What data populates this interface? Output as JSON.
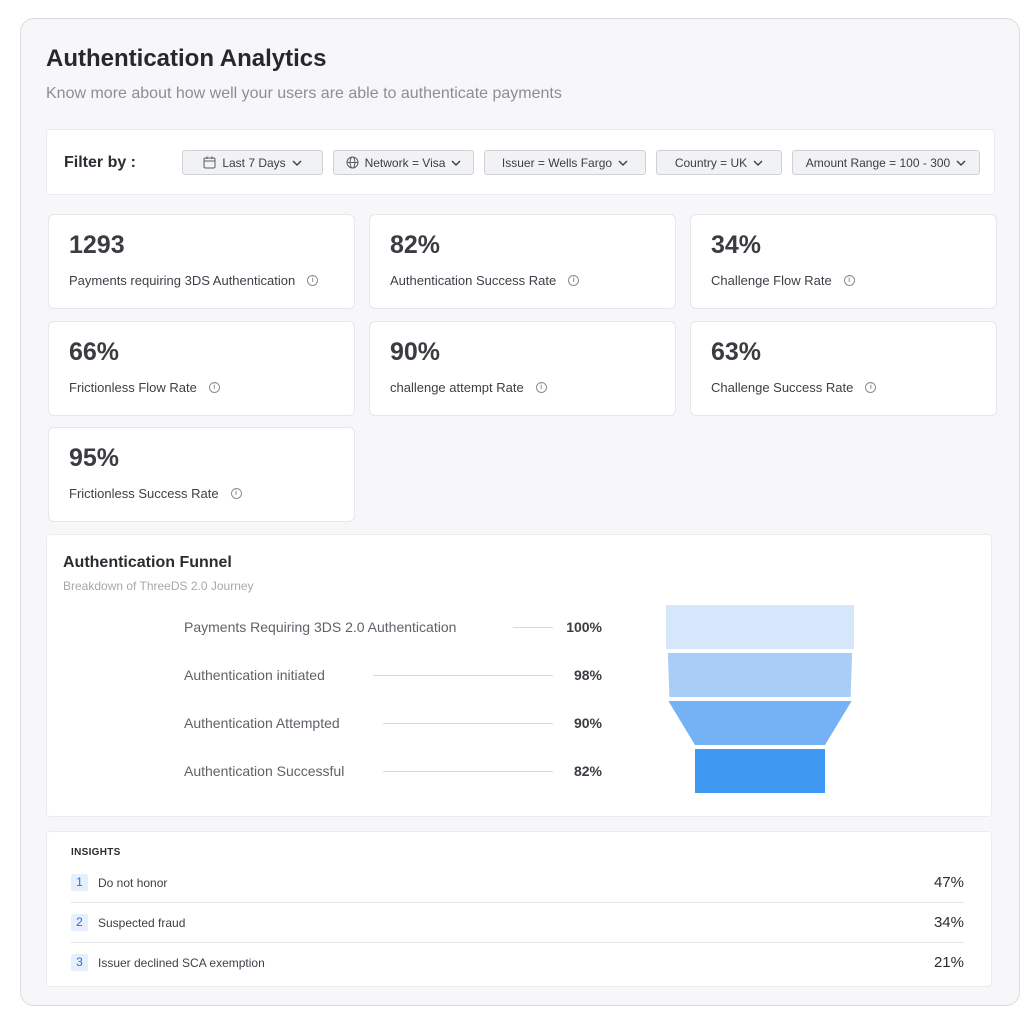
{
  "header": {
    "title": "Authentication Analytics",
    "subtitle": "Know more about how well your users are able to authenticate payments"
  },
  "filters": {
    "label": "Filter by :",
    "chips": [
      {
        "label": "Last 7 Days",
        "icon": "calendar-icon"
      },
      {
        "label": "Network = Visa",
        "icon": "globe-icon"
      },
      {
        "label": "Issuer = Wells Fargo",
        "icon": ""
      },
      {
        "label": "Country = UK",
        "icon": ""
      },
      {
        "label": "Amount Range = 100 - 300",
        "icon": ""
      }
    ]
  },
  "metrics": [
    {
      "value": "1293",
      "label": "Payments requiring 3DS Authentication"
    },
    {
      "value": "82%",
      "label": "Authentication Success Rate"
    },
    {
      "value": "34%",
      "label": "Challenge Flow Rate"
    },
    {
      "value": "66%",
      "label": "Frictionless Flow Rate"
    },
    {
      "value": "90%",
      "label": "challenge attempt Rate"
    },
    {
      "value": "63%",
      "label": "Challenge Success Rate"
    },
    {
      "value": "95%",
      "label": "Frictionless Success Rate"
    }
  ],
  "funnel": {
    "title": "Authentication Funnel",
    "subtitle": "Breakdown of ThreeDS 2.0 Journey",
    "stages": [
      {
        "label": "Payments Requiring 3DS 2.0 Authentication",
        "value": "100%",
        "fraction": 1.0,
        "color": "#d6e6fb"
      },
      {
        "label": "Authentication initiated",
        "value": "98%",
        "fraction": 0.98,
        "color": "#a9cdf7"
      },
      {
        "label": "Authentication Attempted",
        "value": "90%",
        "fraction": 0.9,
        "color": "#74b2f5"
      },
      {
        "label": "Authentication Successful",
        "value": "82%",
        "fraction": 0.82,
        "color": "#3f99f2"
      }
    ]
  },
  "insights": {
    "title": "INSIGHTS",
    "items": [
      {
        "rank": "1",
        "label": "Do not honor",
        "value": "47%"
      },
      {
        "rank": "2",
        "label": "Suspected fraud",
        "value": "34%"
      },
      {
        "rank": "3",
        "label": "Issuer declined SCA exemption",
        "value": "21%"
      }
    ]
  }
}
